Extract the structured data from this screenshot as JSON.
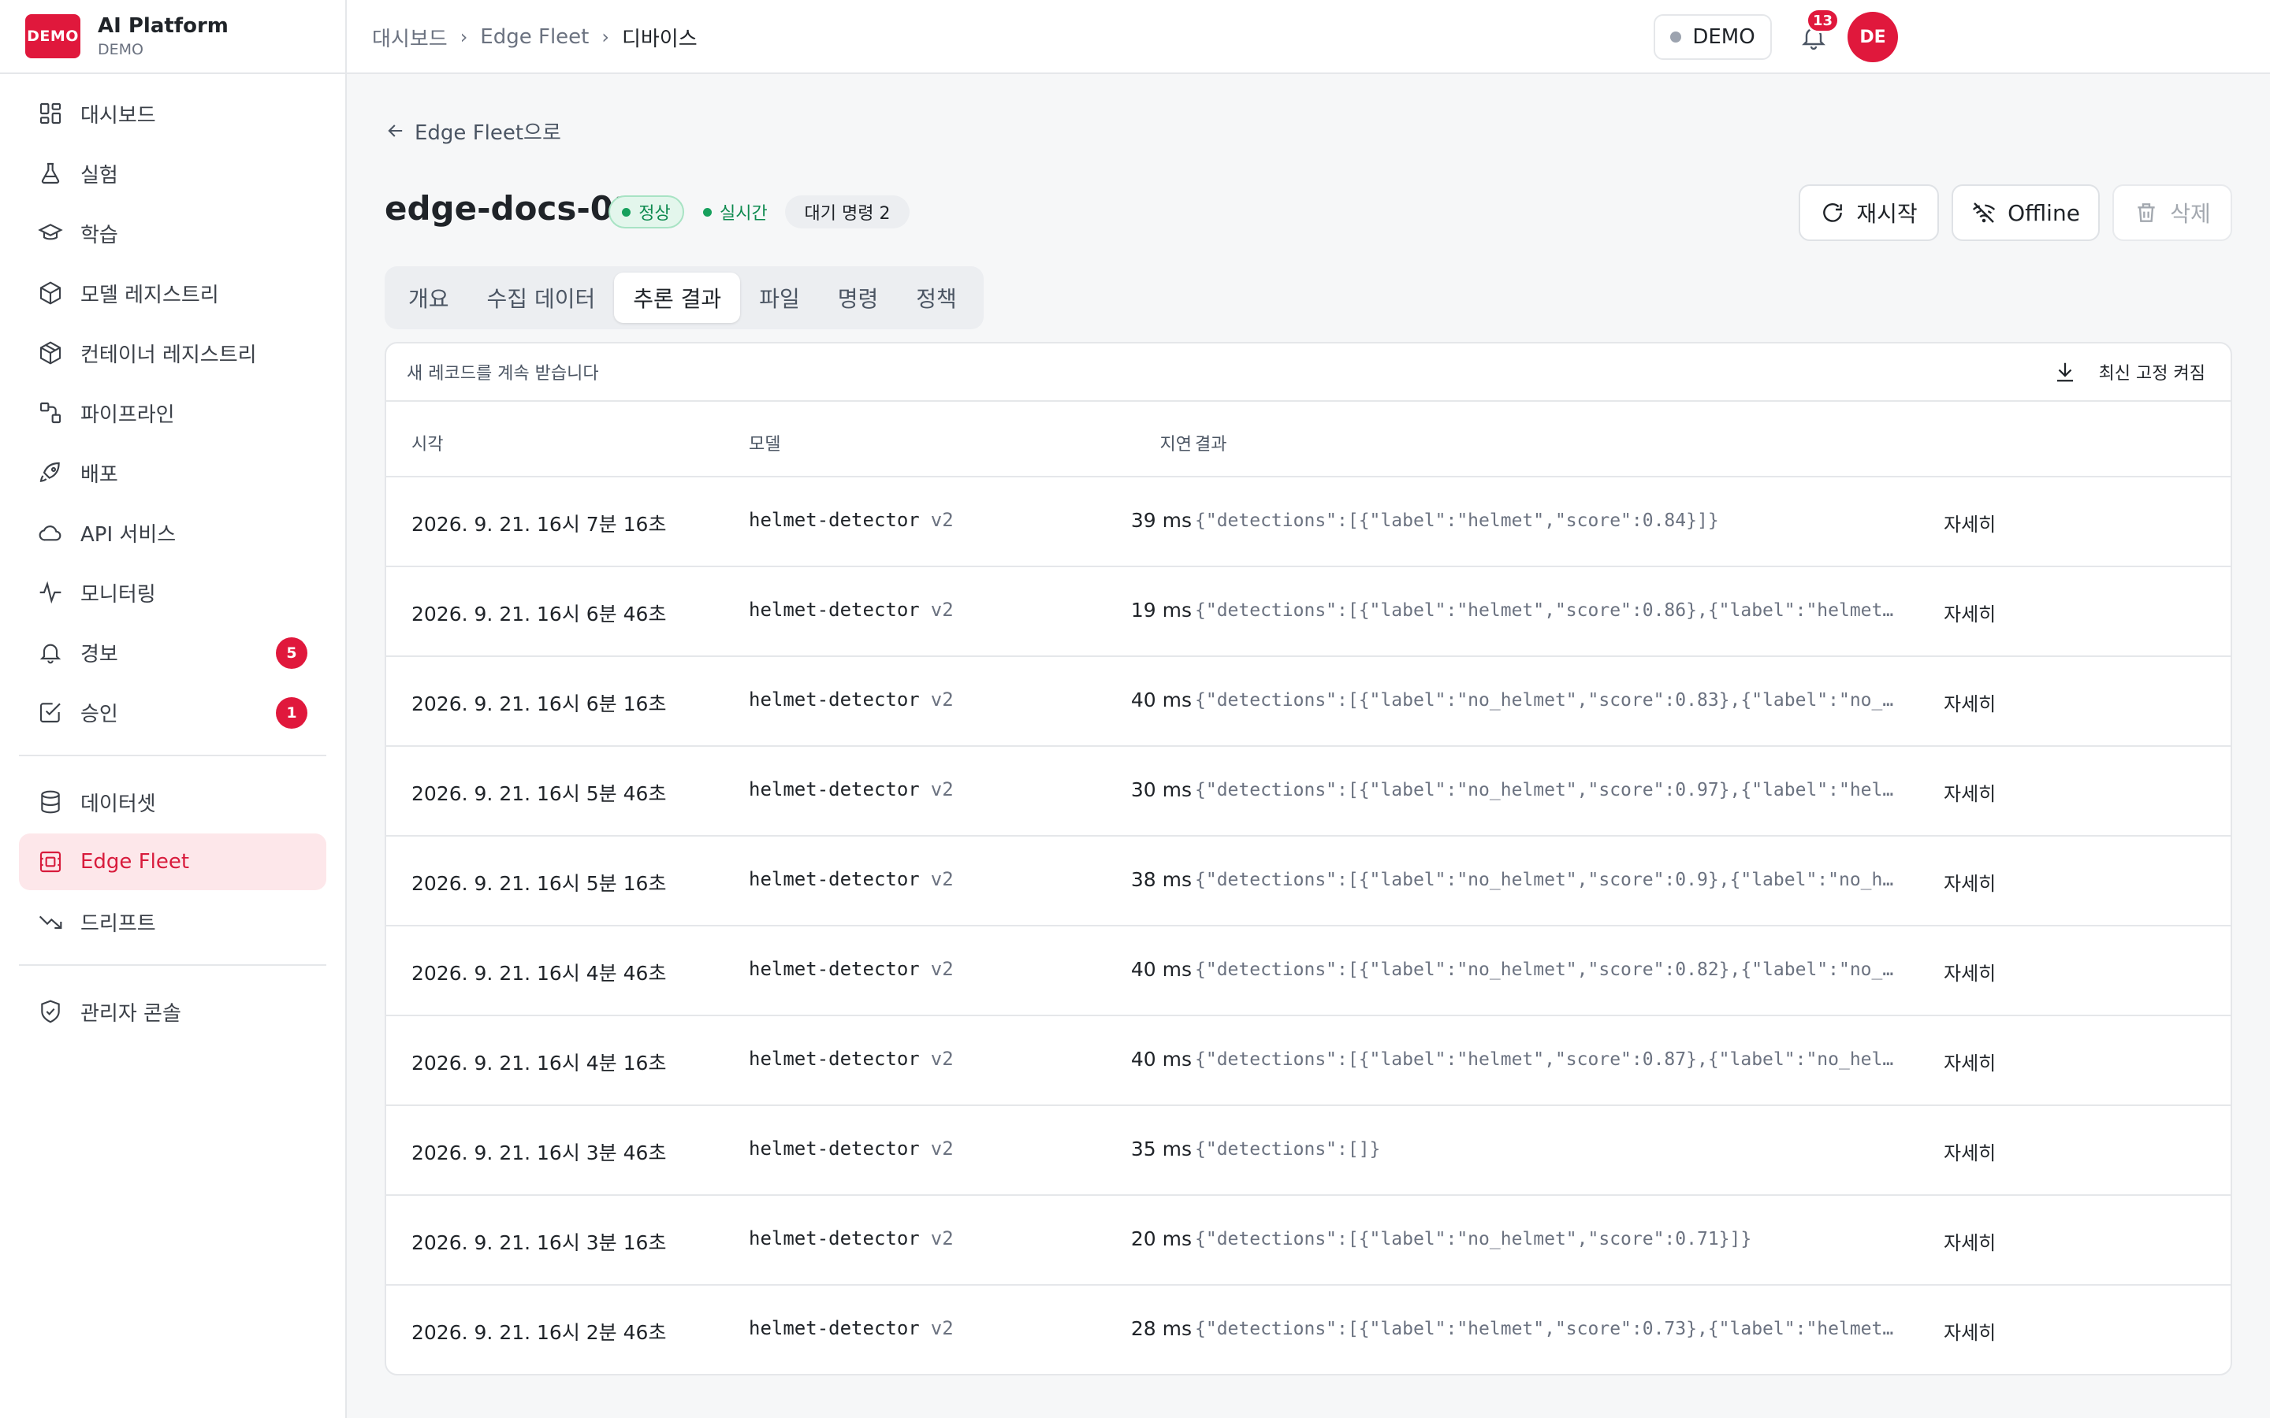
{
  "brand": {
    "logo": "DEMO",
    "title": "AI Platform",
    "subtitle": "DEMO"
  },
  "sidebar": {
    "items": [
      {
        "label": "대시보드",
        "icon": "dashboard-icon"
      },
      {
        "label": "실험",
        "icon": "flask-icon"
      },
      {
        "label": "학습",
        "icon": "graduation-cap-icon"
      },
      {
        "label": "모델 레지스트리",
        "icon": "cube-icon"
      },
      {
        "label": "컨테이너 레지스트리",
        "icon": "container-icon"
      },
      {
        "label": "파이프라인",
        "icon": "pipeline-icon"
      },
      {
        "label": "배포",
        "icon": "rocket-icon"
      },
      {
        "label": "API 서비스",
        "icon": "cloud-icon"
      },
      {
        "label": "모니터링",
        "icon": "activity-icon"
      },
      {
        "label": "경보",
        "icon": "bell-icon",
        "badge": "5"
      },
      {
        "label": "승인",
        "icon": "check-square-icon",
        "badge": "1"
      },
      {
        "label": "데이터셋",
        "icon": "database-icon"
      },
      {
        "label": "Edge Fleet",
        "icon": "edge-device-icon",
        "active": true
      },
      {
        "label": "드리프트",
        "icon": "trend-down-icon"
      },
      {
        "label": "관리자 콘솔",
        "icon": "shield-check-icon"
      }
    ]
  },
  "breadcrumb": {
    "level1": "대시보드",
    "level2": "Edge Fleet",
    "current": "디바이스"
  },
  "topbar": {
    "env_label": "DEMO",
    "notification_count": "13",
    "avatar_initials": "DE"
  },
  "page": {
    "back_label": "Edge Fleet으로",
    "device_name": "edge-docs-01",
    "status_label": "정상",
    "live_label": "실시간",
    "queue_label": "대기 명령 2",
    "restart_label": "재시작",
    "offline_label": "Offline",
    "delete_label": "삭제"
  },
  "tabs": [
    "개요",
    "수집 데이터",
    "추론 결과",
    "파일",
    "명령",
    "정책"
  ],
  "active_tab": "추론 결과",
  "results": {
    "note": "새 레코드를 계속 받습니다",
    "pin_label": "최신 고정 켜짐",
    "columns": {
      "time": "시각",
      "model": "모델",
      "latency": "지연",
      "result": "결과"
    },
    "detail_label": "자세히",
    "rows": [
      {
        "time": "2026. 9. 21. 16시 7분 16초",
        "model": "helmet-detector",
        "version": "v2",
        "latency": "39 ms",
        "result": "{\"detections\":[{\"label\":\"helmet\",\"score\":0.84}]}"
      },
      {
        "time": "2026. 9. 21. 16시 6분 46초",
        "model": "helmet-detector",
        "version": "v2",
        "latency": "19 ms",
        "result": "{\"detections\":[{\"label\":\"helmet\",\"score\":0.86},{\"label\":\"helmet…"
      },
      {
        "time": "2026. 9. 21. 16시 6분 16초",
        "model": "helmet-detector",
        "version": "v2",
        "latency": "40 ms",
        "result": "{\"detections\":[{\"label\":\"no_helmet\",\"score\":0.83},{\"label\":\"no_…"
      },
      {
        "time": "2026. 9. 21. 16시 5분 46초",
        "model": "helmet-detector",
        "version": "v2",
        "latency": "30 ms",
        "result": "{\"detections\":[{\"label\":\"no_helmet\",\"score\":0.97},{\"label\":\"hel…"
      },
      {
        "time": "2026. 9. 21. 16시 5분 16초",
        "model": "helmet-detector",
        "version": "v2",
        "latency": "38 ms",
        "result": "{\"detections\":[{\"label\":\"no_helmet\",\"score\":0.9},{\"label\":\"no_h…"
      },
      {
        "time": "2026. 9. 21. 16시 4분 46초",
        "model": "helmet-detector",
        "version": "v2",
        "latency": "40 ms",
        "result": "{\"detections\":[{\"label\":\"no_helmet\",\"score\":0.82},{\"label\":\"no_…"
      },
      {
        "time": "2026. 9. 21. 16시 4분 16초",
        "model": "helmet-detector",
        "version": "v2",
        "latency": "40 ms",
        "result": "{\"detections\":[{\"label\":\"helmet\",\"score\":0.87},{\"label\":\"no_hel…"
      },
      {
        "time": "2026. 9. 21. 16시 3분 46초",
        "model": "helmet-detector",
        "version": "v2",
        "latency": "35 ms",
        "result": "{\"detections\":[]}"
      },
      {
        "time": "2026. 9. 21. 16시 3분 16초",
        "model": "helmet-detector",
        "version": "v2",
        "latency": "20 ms",
        "result": "{\"detections\":[{\"label\":\"no_helmet\",\"score\":0.71}]}"
      },
      {
        "time": "2026. 9. 21. 16시 2분 46초",
        "model": "helmet-detector",
        "version": "v2",
        "latency": "28 ms",
        "result": "{\"detections\":[{\"label\":\"helmet\",\"score\":0.73},{\"label\":\"helmet…"
      }
    ]
  },
  "colors": {
    "accent": "#e0183c",
    "active_bg": "#fde7ea",
    "ok_green": "#17a05d"
  }
}
